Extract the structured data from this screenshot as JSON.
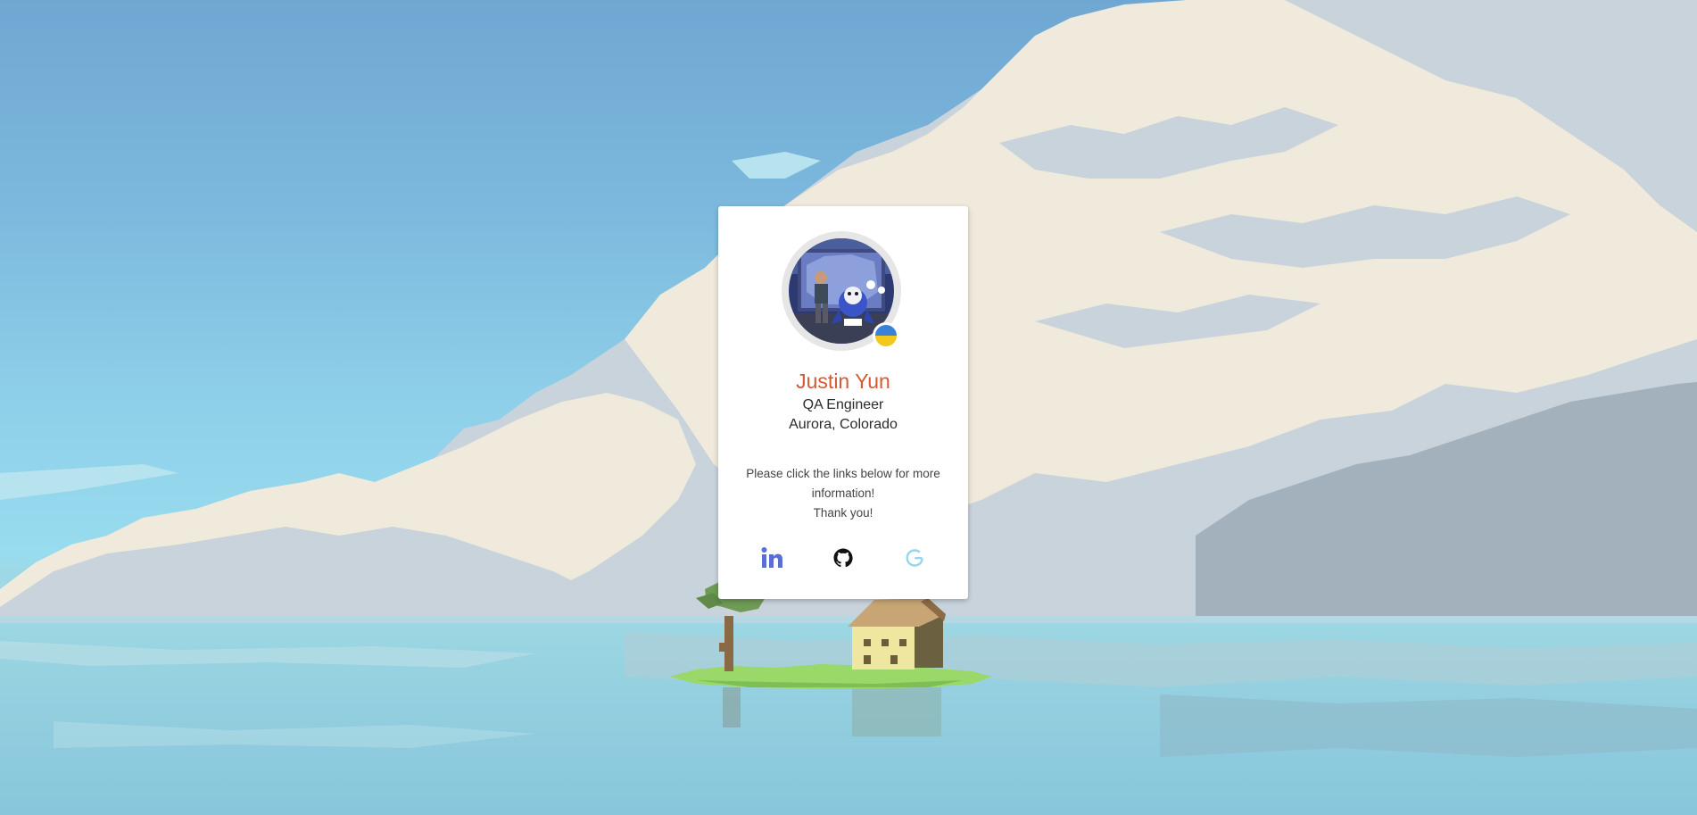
{
  "profile": {
    "name": "Justin Yun",
    "role": "QA Engineer",
    "location": "Aurora, Colorado",
    "message_line1": "Please click the links below for more information!",
    "message_line2": "Thank you!"
  },
  "links": [
    {
      "icon": "linkedin-icon",
      "color": "#5b6ed6"
    },
    {
      "icon": "github-icon",
      "color": "#111111"
    },
    {
      "icon": "google-icon",
      "color": "#9ad3ec"
    }
  ],
  "colors": {
    "name": "#d35a35",
    "flag_top": "#3b82d6",
    "flag_bottom": "#f2c81d"
  }
}
